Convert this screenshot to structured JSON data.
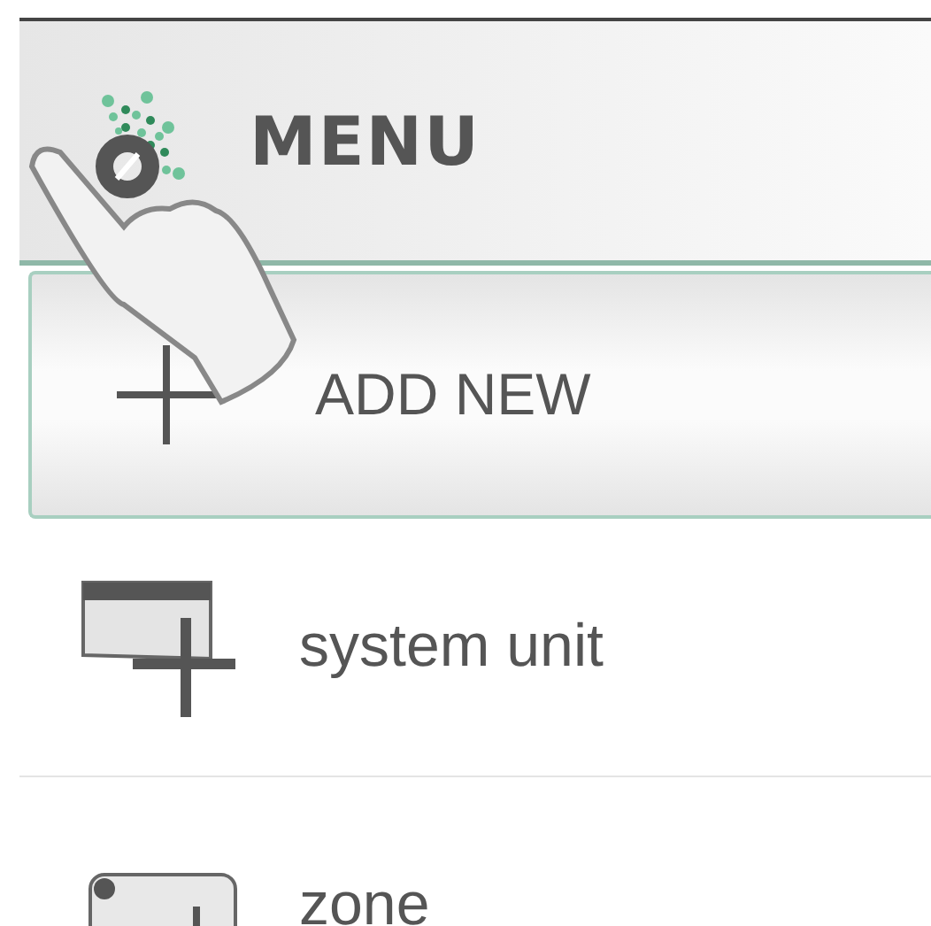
{
  "header": {
    "title": "MENU"
  },
  "add_button": {
    "label": "ADD NEW"
  },
  "items": [
    {
      "label": "system unit",
      "kind": "system-unit"
    },
    {
      "label": "zone",
      "kind": "zone"
    }
  ]
}
